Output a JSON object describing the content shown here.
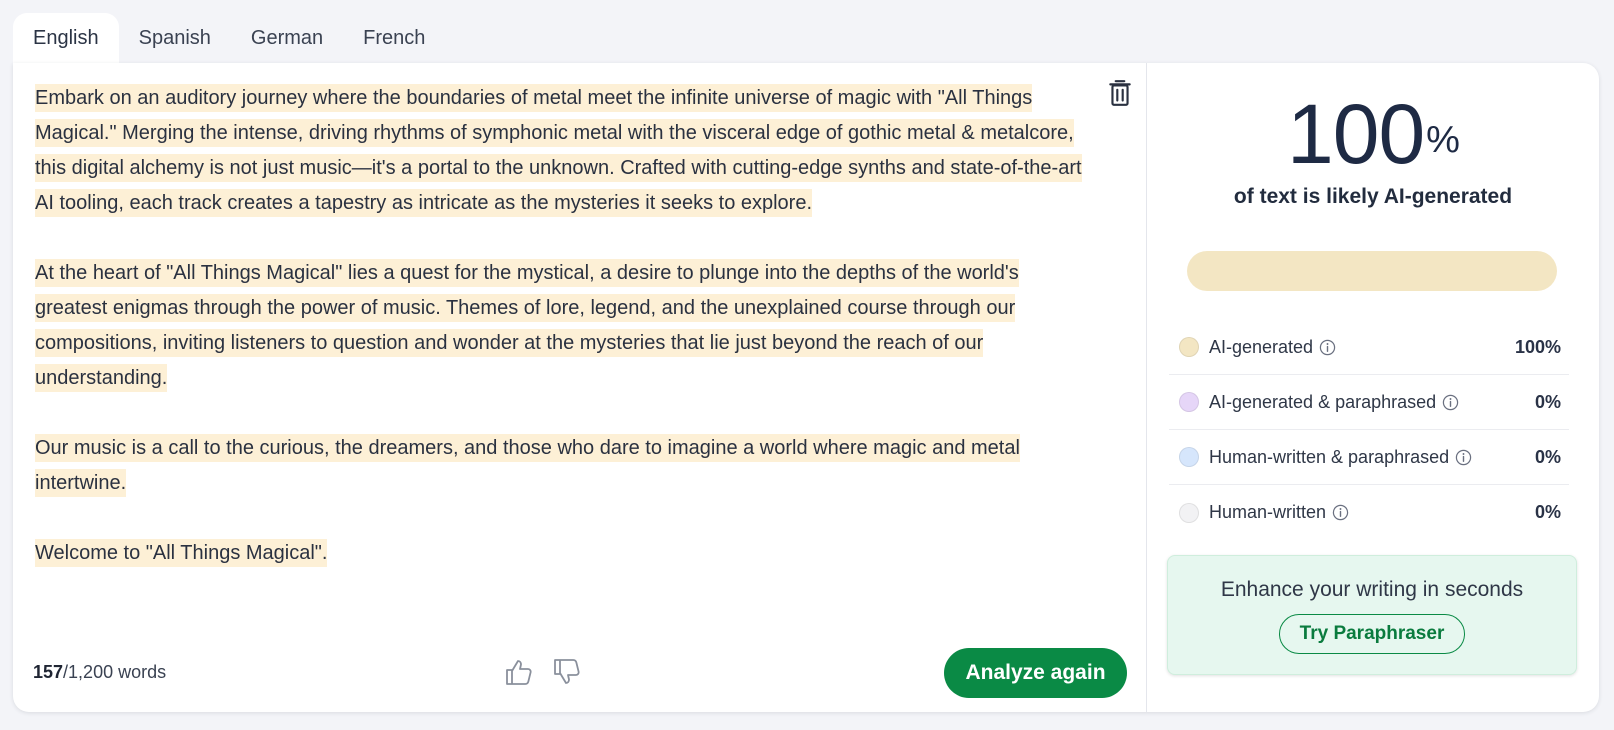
{
  "tabs": [
    "English",
    "Spanish",
    "German",
    "French"
  ],
  "editor": {
    "paragraphs": [
      "Embark on an auditory journey where the boundaries of metal meet the infinite universe of magic with \"All Things Magical.\" Merging the intense, driving rhythms of symphonic metal with the visceral edge of gothic metal & metalcore, this digital alchemy is not just music—it's a portal to the unknown. Crafted with cutting-edge synths and state-of-the-art AI tooling, each track creates a tapestry as intricate as the mysteries it seeks to explore.",
      "At the heart of \"All Things Magical\" lies a quest for the mystical, a desire to plunge into the depths of the world's greatest enigmas through the power of music. Themes of lore, legend, and the unexplained course through our compositions, inviting listeners to question and wonder at the mysteries that lie just beyond the reach of our understanding.",
      "Our music is a call to the curious, the dreamers, and those who dare to imagine a world where magic and metal intertwine.",
      "Welcome to \"All Things Magical\"."
    ],
    "highlight_color": "#fdf0d6"
  },
  "footer": {
    "word_count": "157",
    "word_limit": "/1,200 words",
    "analyze_label": "Analyze again"
  },
  "results": {
    "score": "100",
    "score_unit": "%",
    "caption": "of text is likely AI-generated",
    "bar_fraction": 1.0,
    "legend": [
      {
        "label": "AI-generated",
        "value": "100%",
        "color": "#f3e6c3"
      },
      {
        "label": "AI-generated & paraphrased",
        "value": "0%",
        "color": "#e6d6f8"
      },
      {
        "label": "Human-written & paraphrased",
        "value": "0%",
        "color": "#d6e6fc"
      },
      {
        "label": "Human-written",
        "value": "0%",
        "color": "#f2f2f4"
      }
    ],
    "promo_title": "Enhance your writing in seconds",
    "promo_button": "Try Paraphraser"
  },
  "colors": {
    "accent_green": "#0a8a45",
    "navy": "#1e2a44"
  }
}
